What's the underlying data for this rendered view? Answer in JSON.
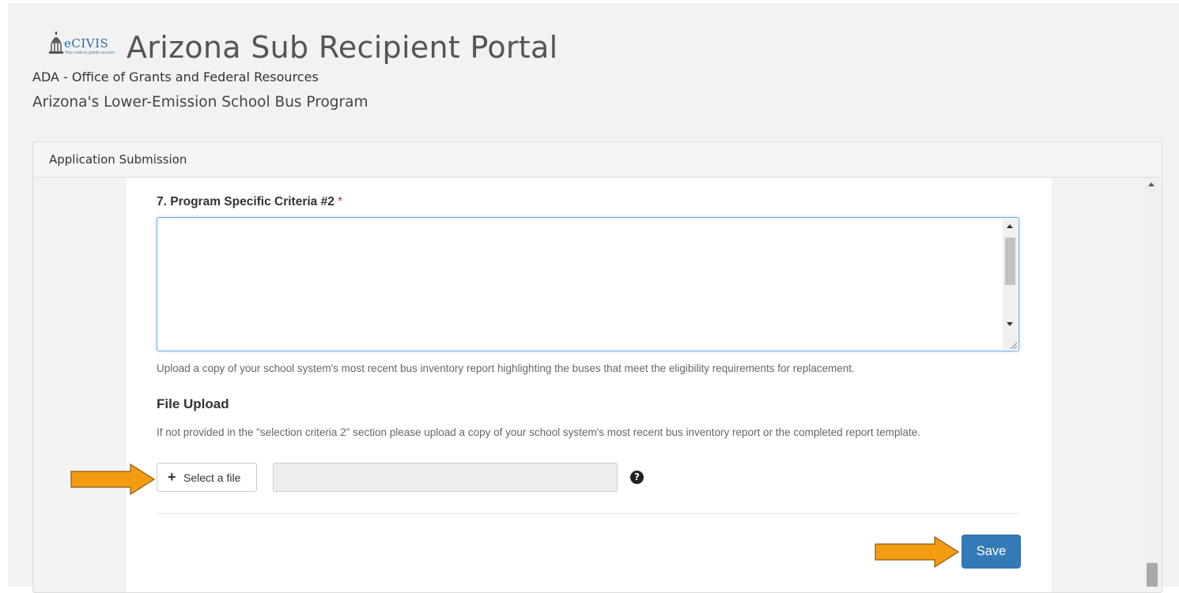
{
  "header": {
    "logo_text": "eCIVIS",
    "logo_tagline": "Your route to grants success",
    "app_title": "Arizona Sub Recipient Portal",
    "org_name": "ADA - Office of Grants and Federal Resources",
    "program_name": "Arizona's Lower-Emission School Bus Program"
  },
  "panel": {
    "heading": "Application Submission"
  },
  "question": {
    "label": "7. Program Specific Criteria #2",
    "required_marker": "*",
    "textarea_value": "",
    "help_text": "Upload a copy of your school system's most recent bus inventory report highlighting the buses that meet the eligibility requirements for replacement."
  },
  "file_upload": {
    "title": "File Upload",
    "description": "If not provided in the \"selection criteria 2\" section please upload a copy of your school system's most recent bus inventory report or the completed report template.",
    "select_button_icon": "+",
    "select_button_label": "Select a file",
    "file_name_value": "",
    "help_icon_glyph": "?"
  },
  "actions": {
    "save_label": "Save"
  },
  "colors": {
    "primary_button": "#337ab7",
    "required": "#c0392b",
    "annotation_arrow": "#f39c12"
  }
}
